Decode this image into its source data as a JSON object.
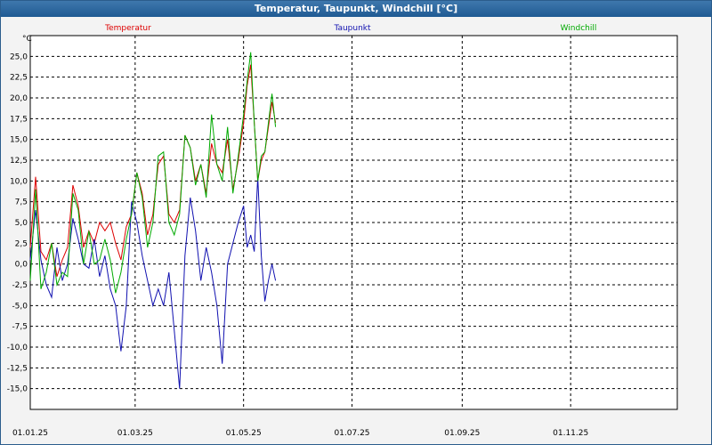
{
  "window": {
    "title": "Temperatur, Taupunkt, Windchill [°C]"
  },
  "chart_data": {
    "type": "line",
    "title": "Temperatur, Taupunkt, Windchill [°C]",
    "ylabel": "°C",
    "xlabel": "",
    "ylim": [
      -17.5,
      27.5
    ],
    "xlim": [
      "2025-01-01",
      "2025-12-31"
    ],
    "grid": true,
    "legend_position": "top",
    "y_ticks": [
      "25,0",
      "22,5",
      "20,0",
      "17,5",
      "15,0",
      "12,5",
      "10,0",
      "7,5",
      "5,0",
      "2,5",
      "0,0",
      "-2,5",
      "-5,0",
      "-7,5",
      "-10,0",
      "-12,5",
      "-15,0"
    ],
    "x_ticks": [
      {
        "date": "2025-01-01",
        "label": "01.01.25"
      },
      {
        "date": "2025-03-01",
        "label": "01.03.25"
      },
      {
        "date": "2025-05-01",
        "label": "01.05.25"
      },
      {
        "date": "2025-07-01",
        "label": "01.07.25"
      },
      {
        "date": "2025-09-01",
        "label": "01.09.25"
      },
      {
        "date": "2025-11-01",
        "label": "01.11.25"
      }
    ],
    "series": [
      {
        "name": "Temperatur",
        "color": "#dd0000",
        "points": [
          [
            "2025-01-01",
            2.0
          ],
          [
            "2025-01-04",
            10.5
          ],
          [
            "2025-01-07",
            1.5
          ],
          [
            "2025-01-10",
            0.5
          ],
          [
            "2025-01-13",
            2.5
          ],
          [
            "2025-01-16",
            -1.5
          ],
          [
            "2025-01-19",
            0.5
          ],
          [
            "2025-01-22",
            2.0
          ],
          [
            "2025-01-25",
            9.5
          ],
          [
            "2025-01-28",
            7.0
          ],
          [
            "2025-01-31",
            2.0
          ],
          [
            "2025-02-03",
            4.0
          ],
          [
            "2025-02-06",
            2.5
          ],
          [
            "2025-02-09",
            5.0
          ],
          [
            "2025-02-12",
            4.0
          ],
          [
            "2025-02-15",
            5.0
          ],
          [
            "2025-02-18",
            2.5
          ],
          [
            "2025-02-21",
            0.5
          ],
          [
            "2025-02-24",
            4.5
          ],
          [
            "2025-02-27",
            6.0
          ],
          [
            "2025-03-02",
            11.0
          ],
          [
            "2025-03-05",
            8.5
          ],
          [
            "2025-03-08",
            3.5
          ],
          [
            "2025-03-11",
            6.0
          ],
          [
            "2025-03-14",
            12.0
          ],
          [
            "2025-03-17",
            13.0
          ],
          [
            "2025-03-20",
            6.0
          ],
          [
            "2025-03-23",
            5.0
          ],
          [
            "2025-03-26",
            6.5
          ],
          [
            "2025-03-29",
            15.5
          ],
          [
            "2025-04-01",
            14.0
          ],
          [
            "2025-04-04",
            10.0
          ],
          [
            "2025-04-07",
            12.0
          ],
          [
            "2025-04-10",
            8.5
          ],
          [
            "2025-04-13",
            14.5
          ],
          [
            "2025-04-16",
            12.0
          ],
          [
            "2025-04-19",
            11.0
          ],
          [
            "2025-04-22",
            15.0
          ],
          [
            "2025-04-25",
            9.0
          ],
          [
            "2025-04-28",
            12.5
          ],
          [
            "2025-05-01",
            17.0
          ],
          [
            "2025-05-03",
            21.5
          ],
          [
            "2025-05-05",
            24.0
          ],
          [
            "2025-05-07",
            17.0
          ],
          [
            "2025-05-09",
            10.0
          ],
          [
            "2025-05-11",
            12.5
          ],
          [
            "2025-05-13",
            13.5
          ],
          [
            "2025-05-15",
            16.5
          ],
          [
            "2025-05-17",
            19.5
          ],
          [
            "2025-05-19",
            17.0
          ]
        ]
      },
      {
        "name": "Taupunkt",
        "color": "#1010b0",
        "points": [
          [
            "2025-01-01",
            0.5
          ],
          [
            "2025-01-04",
            6.5
          ],
          [
            "2025-01-07",
            0.5
          ],
          [
            "2025-01-10",
            -2.5
          ],
          [
            "2025-01-13",
            -4.0
          ],
          [
            "2025-01-16",
            2.0
          ],
          [
            "2025-01-19",
            -2.0
          ],
          [
            "2025-01-22",
            0.0
          ],
          [
            "2025-01-25",
            5.5
          ],
          [
            "2025-01-28",
            3.0
          ],
          [
            "2025-01-31",
            0.0
          ],
          [
            "2025-02-03",
            -0.5
          ],
          [
            "2025-02-06",
            3.0
          ],
          [
            "2025-02-09",
            -1.5
          ],
          [
            "2025-02-12",
            1.0
          ],
          [
            "2025-02-15",
            -3.0
          ],
          [
            "2025-02-18",
            -5.0
          ],
          [
            "2025-02-21",
            -10.5
          ],
          [
            "2025-02-24",
            -5.0
          ],
          [
            "2025-02-27",
            7.5
          ],
          [
            "2025-03-02",
            5.0
          ],
          [
            "2025-03-05",
            1.0
          ],
          [
            "2025-03-08",
            -2.0
          ],
          [
            "2025-03-11",
            -5.0
          ],
          [
            "2025-03-14",
            -3.0
          ],
          [
            "2025-03-17",
            -5.0
          ],
          [
            "2025-03-20",
            -1.0
          ],
          [
            "2025-03-23",
            -8.0
          ],
          [
            "2025-03-26",
            -15.0
          ],
          [
            "2025-03-29",
            1.0
          ],
          [
            "2025-04-01",
            8.0
          ],
          [
            "2025-04-04",
            4.0
          ],
          [
            "2025-04-07",
            -2.0
          ],
          [
            "2025-04-10",
            2.0
          ],
          [
            "2025-04-13",
            -1.0
          ],
          [
            "2025-04-16",
            -5.0
          ],
          [
            "2025-04-19",
            -12.0
          ],
          [
            "2025-04-22",
            0.0
          ],
          [
            "2025-04-25",
            2.5
          ],
          [
            "2025-04-28",
            5.0
          ],
          [
            "2025-05-01",
            7.0
          ],
          [
            "2025-05-03",
            2.0
          ],
          [
            "2025-05-05",
            3.5
          ],
          [
            "2025-05-07",
            1.5
          ],
          [
            "2025-05-09",
            10.5
          ],
          [
            "2025-05-11",
            1.0
          ],
          [
            "2025-05-13",
            -4.5
          ],
          [
            "2025-05-15",
            -2.0
          ],
          [
            "2025-05-17",
            0.0
          ],
          [
            "2025-05-19",
            -2.0
          ]
        ]
      },
      {
        "name": "Windchill",
        "color": "#00aa00",
        "points": [
          [
            "2025-01-01",
            -2.0
          ],
          [
            "2025-01-04",
            9.0
          ],
          [
            "2025-01-07",
            -3.0
          ],
          [
            "2025-01-10",
            -1.0
          ],
          [
            "2025-01-13",
            2.5
          ],
          [
            "2025-01-16",
            -2.5
          ],
          [
            "2025-01-19",
            -1.0
          ],
          [
            "2025-01-22",
            -1.5
          ],
          [
            "2025-01-25",
            8.5
          ],
          [
            "2025-01-28",
            6.5
          ],
          [
            "2025-01-31",
            0.0
          ],
          [
            "2025-02-03",
            4.0
          ],
          [
            "2025-02-06",
            0.0
          ],
          [
            "2025-02-09",
            0.5
          ],
          [
            "2025-02-12",
            3.0
          ],
          [
            "2025-02-15",
            0.5
          ],
          [
            "2025-02-18",
            -3.5
          ],
          [
            "2025-02-21",
            -1.0
          ],
          [
            "2025-02-24",
            3.0
          ],
          [
            "2025-02-27",
            6.0
          ],
          [
            "2025-03-02",
            11.0
          ],
          [
            "2025-03-05",
            8.0
          ],
          [
            "2025-03-08",
            2.0
          ],
          [
            "2025-03-11",
            5.0
          ],
          [
            "2025-03-14",
            13.0
          ],
          [
            "2025-03-17",
            13.5
          ],
          [
            "2025-03-20",
            5.0
          ],
          [
            "2025-03-23",
            3.5
          ],
          [
            "2025-03-26",
            6.0
          ],
          [
            "2025-03-29",
            15.5
          ],
          [
            "2025-04-01",
            14.0
          ],
          [
            "2025-04-04",
            9.5
          ],
          [
            "2025-04-07",
            12.0
          ],
          [
            "2025-04-10",
            8.0
          ],
          [
            "2025-04-13",
            18.0
          ],
          [
            "2025-04-16",
            12.0
          ],
          [
            "2025-04-19",
            10.0
          ],
          [
            "2025-04-22",
            16.5
          ],
          [
            "2025-04-25",
            8.5
          ],
          [
            "2025-04-28",
            13.0
          ],
          [
            "2025-05-01",
            18.0
          ],
          [
            "2025-05-03",
            22.0
          ],
          [
            "2025-05-05",
            25.5
          ],
          [
            "2025-05-07",
            17.0
          ],
          [
            "2025-05-09",
            10.0
          ],
          [
            "2025-05-11",
            13.0
          ],
          [
            "2025-05-13",
            13.5
          ],
          [
            "2025-05-15",
            17.0
          ],
          [
            "2025-05-17",
            20.5
          ],
          [
            "2025-05-19",
            16.5
          ]
        ]
      }
    ]
  }
}
